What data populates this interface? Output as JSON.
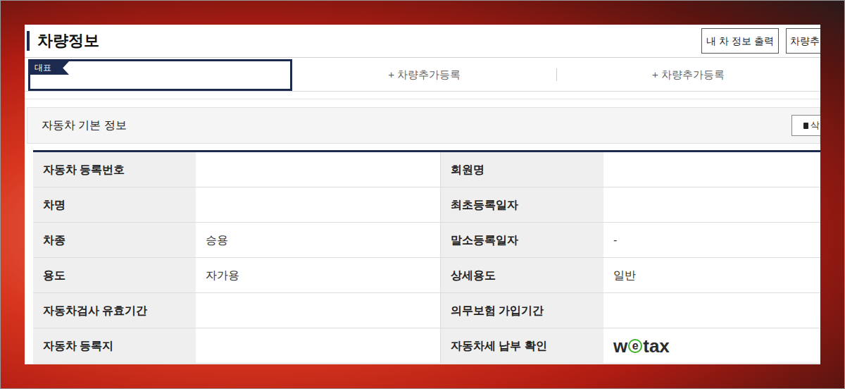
{
  "page": {
    "title": "차량정보"
  },
  "header_buttons": [
    "내 차 정보 출력",
    "차량추"
  ],
  "tabs": [
    {
      "badge": "대표",
      "label": "",
      "selected": true
    },
    {
      "label": "+ 차량추가등록",
      "selected": false
    },
    {
      "label": "+ 차량추가등록",
      "selected": false
    }
  ],
  "section": {
    "title": "자동차 기본 정보",
    "button": "삭"
  },
  "table": {
    "rows": [
      [
        "자동차 등록번호",
        "",
        "회원명",
        ""
      ],
      [
        "차명",
        "",
        "최초등록일자",
        ""
      ],
      [
        "차종",
        "승용",
        "말소등록일자",
        "-"
      ],
      [
        "용도",
        "자가용",
        "상세용도",
        "일반"
      ],
      [
        "자동차검사 유효기간",
        "",
        "의무보험 가입기간",
        ""
      ],
      [
        "자동차 등록지",
        "",
        "자동차세 납부 확인"
      ]
    ],
    "tax_logo": [
      "w",
      "e",
      "tax"
    ]
  }
}
